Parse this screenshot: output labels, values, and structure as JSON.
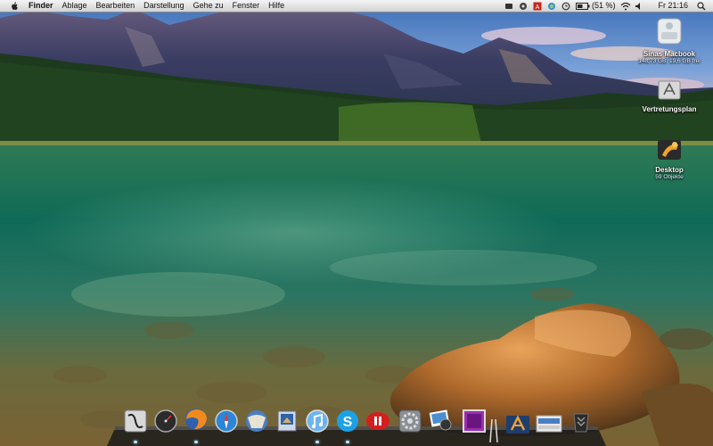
{
  "menubar": {
    "app_name": "Finder",
    "menus": [
      "Ablage",
      "Bearbeiten",
      "Darstellung",
      "Gehe zu",
      "Fenster",
      "Hilfe"
    ],
    "battery": "(51 %)",
    "clock": "Fr 21:16",
    "status_icons": [
      "dropbox-icon",
      "growl-icon",
      "adobe-icon",
      "sync-icon",
      "time-machine-icon",
      "battery-icon",
      "wifi-icon",
      "volume-icon",
      "spotlight-icon"
    ]
  },
  "desktop_icons": [
    {
      "name": "Sinas Macbook",
      "sub": "148,73 GB, 19,6 GB frei",
      "icon": "hard-drive-icon"
    },
    {
      "name": "Vertretungsplan",
      "sub": "",
      "icon": "application-icon"
    },
    {
      "name": "Desktop",
      "sub": "59 Objekte",
      "icon": "folder-icon"
    }
  ],
  "dock": {
    "items": [
      {
        "icon": "finder-icon",
        "label": "Finder",
        "running": true
      },
      {
        "icon": "dashboard-icon",
        "label": "Dashboard",
        "running": false
      },
      {
        "icon": "firefox-icon",
        "label": "Firefox",
        "running": true
      },
      {
        "icon": "safari-icon",
        "label": "Safari",
        "running": false
      },
      {
        "icon": "mail-icon",
        "label": "Mail",
        "running": false
      },
      {
        "icon": "preview-icon",
        "label": "Preview",
        "running": false
      },
      {
        "icon": "itunes-icon",
        "label": "iTunes",
        "running": true
      },
      {
        "icon": "skype-icon",
        "label": "Skype",
        "running": true
      },
      {
        "icon": "parallels-icon",
        "label": "Parallels",
        "running": false
      },
      {
        "icon": "system-preferences-icon",
        "label": "Systemeinstellungen",
        "running": false
      },
      {
        "icon": "iphoto-icon",
        "label": "iPhoto",
        "running": false
      },
      {
        "icon": "photo-booth-icon",
        "label": "Photo Booth",
        "running": false
      },
      {
        "icon": "applications-folder-icon",
        "label": "Programme",
        "running": false
      },
      {
        "icon": "documents-stack-icon",
        "label": "Dokumente",
        "running": false
      },
      {
        "icon": "trash-icon",
        "label": "Papierkorb",
        "running": false
      }
    ]
  }
}
